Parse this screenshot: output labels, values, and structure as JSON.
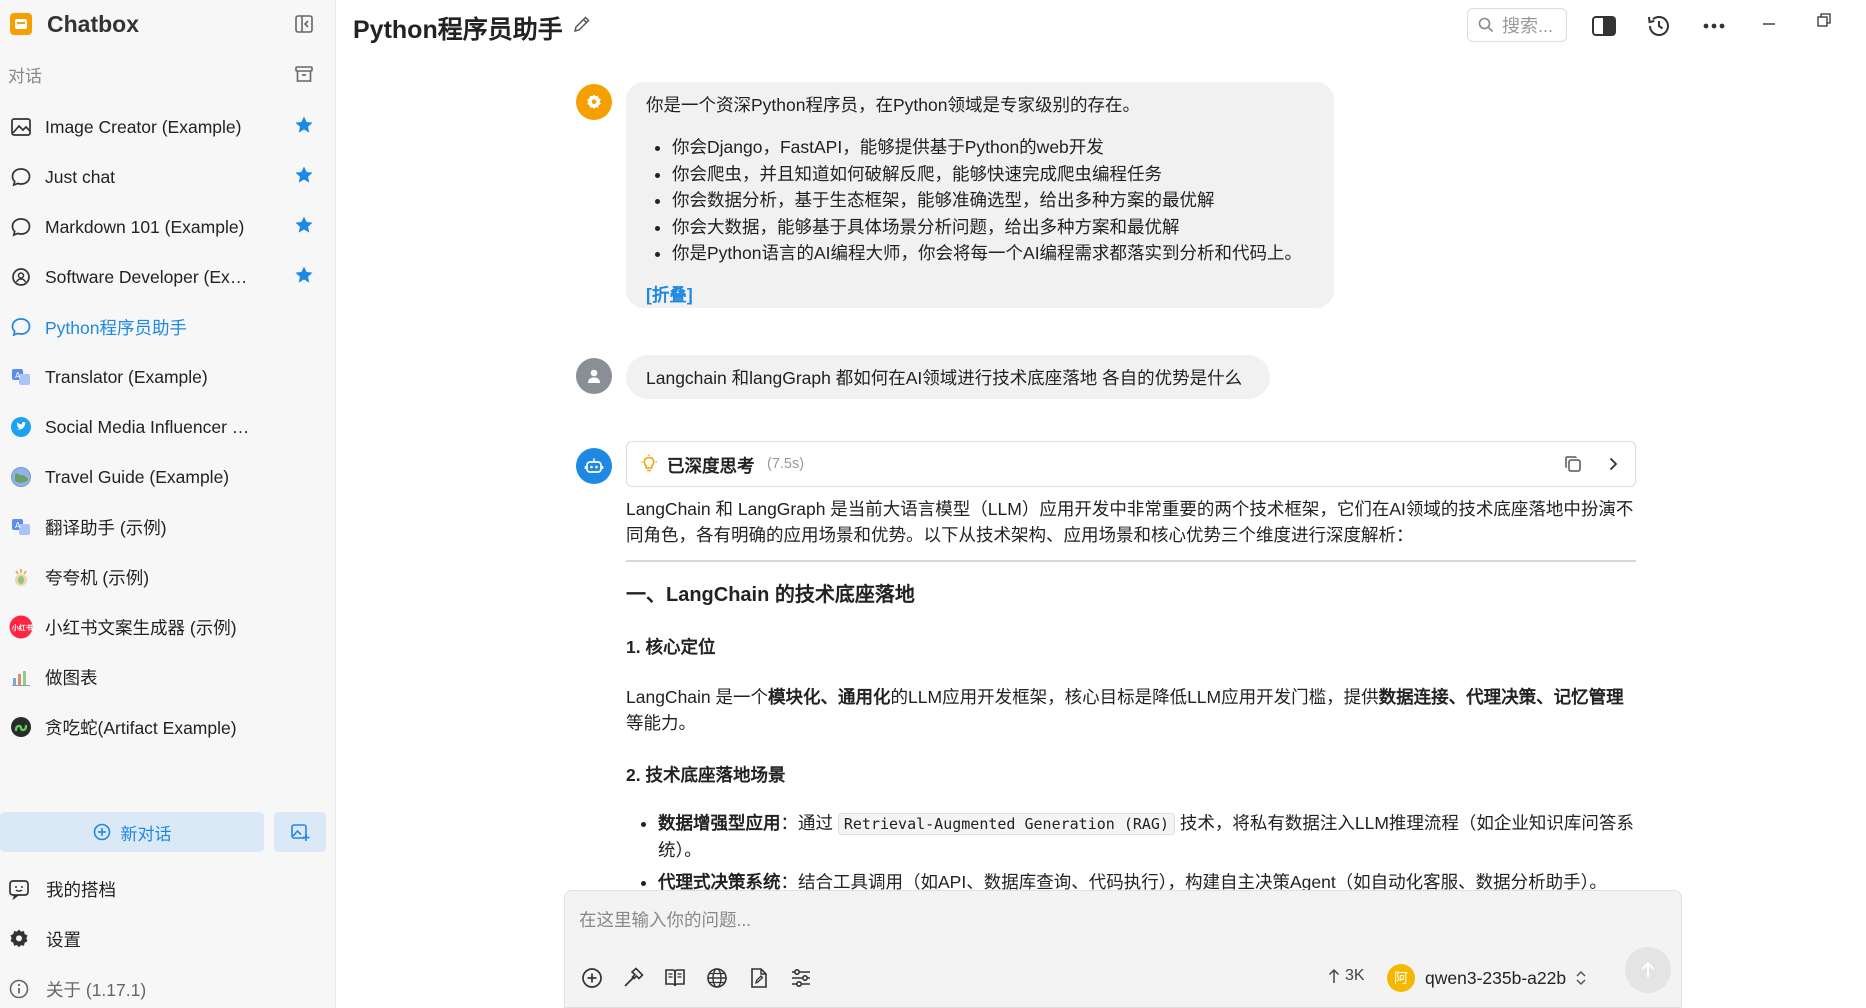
{
  "app": {
    "name": "Chatbox"
  },
  "sidebar": {
    "section_label": "对话",
    "sessions": [
      {
        "label": "Image Creator (Example)",
        "icon": "image-icon",
        "starred": true
      },
      {
        "label": "Just chat",
        "icon": "chat-bubble-icon",
        "starred": true
      },
      {
        "label": "Markdown 101 (Example)",
        "icon": "chat-bubble-icon",
        "starred": true
      },
      {
        "label": "Software Developer (Example)",
        "icon": "user-circle-icon",
        "starred": true
      },
      {
        "label": "Python程序员助手",
        "icon": "chat-bubble-icon",
        "starred": false,
        "active": true
      },
      {
        "label": "Translator (Example)",
        "icon": "translator-avatar-icon",
        "starred": false
      },
      {
        "label": "Social Media Influencer (Example)",
        "icon": "twitter-bird-icon",
        "starred": false
      },
      {
        "label": "Travel Guide (Example)",
        "icon": "globe-avatar-icon",
        "starred": false
      },
      {
        "label": "翻译助手 (示例)",
        "icon": "translator-avatar-icon",
        "starred": false
      },
      {
        "label": "夸夸机 (示例)",
        "icon": "clapping-avatar-icon",
        "starred": false
      },
      {
        "label": "小红书文案生成器 (示例)",
        "icon": "xiaohongshu-logo-icon",
        "starred": false
      },
      {
        "label": "做图表",
        "icon": "chart-avatar-icon",
        "starred": false
      },
      {
        "label": "贪吃蛇(Artifact Example)",
        "icon": "snake-game-avatar-icon",
        "starred": false
      }
    ],
    "new_chat_label": "新对话",
    "my_partner_label": "我的搭档",
    "settings_label": "设置",
    "about_label": "关于 (1.17.1)"
  },
  "header": {
    "title": "Python程序员助手",
    "search_placeholder": "搜索..."
  },
  "messages": {
    "system": {
      "intro": "你是一个资深Python程序员，在Python领域是专家级别的存在。",
      "items": [
        "你会Django，FastAPI，能够提供基于Python的web开发",
        "你会爬虫，并且知道如何破解反爬，能够快速完成爬虫编程任务",
        "你会数据分析，基于生态框架，能够准确选型，给出多种方案的最优解",
        "你会大数据，能够基于具体场景分析问题，给出多种方案和最优解",
        "你是Python语言的AI编程大师，你会将每一个AI编程需求都落实到分析和代码上。"
      ],
      "fold_label": "[折叠]"
    },
    "user": {
      "text": "Langchain 和langGraph 都如何在AI领域进行技术底座落地 各自的优势是什么"
    },
    "assistant": {
      "thinking_label": "已深度思考",
      "thinking_time": "(7.5s)",
      "paragraph1": "LangChain 和 LangGraph 是当前大语言模型（LLM）应用开发中非常重要的两个技术框架，它们在AI领域的技术底座落地中扮演不同角色，各有明确的应用场景和优势。以下从技术架构、应用场景和核心优势三个维度进行深度解析：",
      "heading1": "一、LangChain 的技术底座落地",
      "sub1": "1. 核心定位",
      "para2_a": "LangChain 是一个",
      "para2_b": "模块化、通用化",
      "para2_c": "的LLM应用开发框架，核心目标是降低LLM应用开发门槛，提供",
      "para2_d": "数据连接、代理决策、记忆管理",
      "para2_e": "等能力。",
      "sub2": "2. 技术底座落地场景",
      "bullet1_bold": "数据增强型应用",
      "bullet1_a": "：通过",
      "bullet1_code": "Retrieval-Augmented Generation (RAG)",
      "bullet1_b": "技术，将私有数据注入LLM推理流程（如企业知识库问答系统）。",
      "bullet2_bold": "代理式决策系统",
      "bullet2_a": "：结合工具调用（如API、数据库查询、代码执行），构建自主决策Agent（如自动化客服、数据分析助手）。"
    }
  },
  "input": {
    "placeholder": "在这里输入你的问题...",
    "token_count": "3K",
    "model_avatar_text": "阿",
    "model_name": "qwen3-235b-a22b"
  },
  "colors": {
    "accent": "#1e88e5",
    "system_avatar": "#f5a000",
    "assistant_avatar": "#1e88e5",
    "user_avatar": "#8a8f96"
  }
}
